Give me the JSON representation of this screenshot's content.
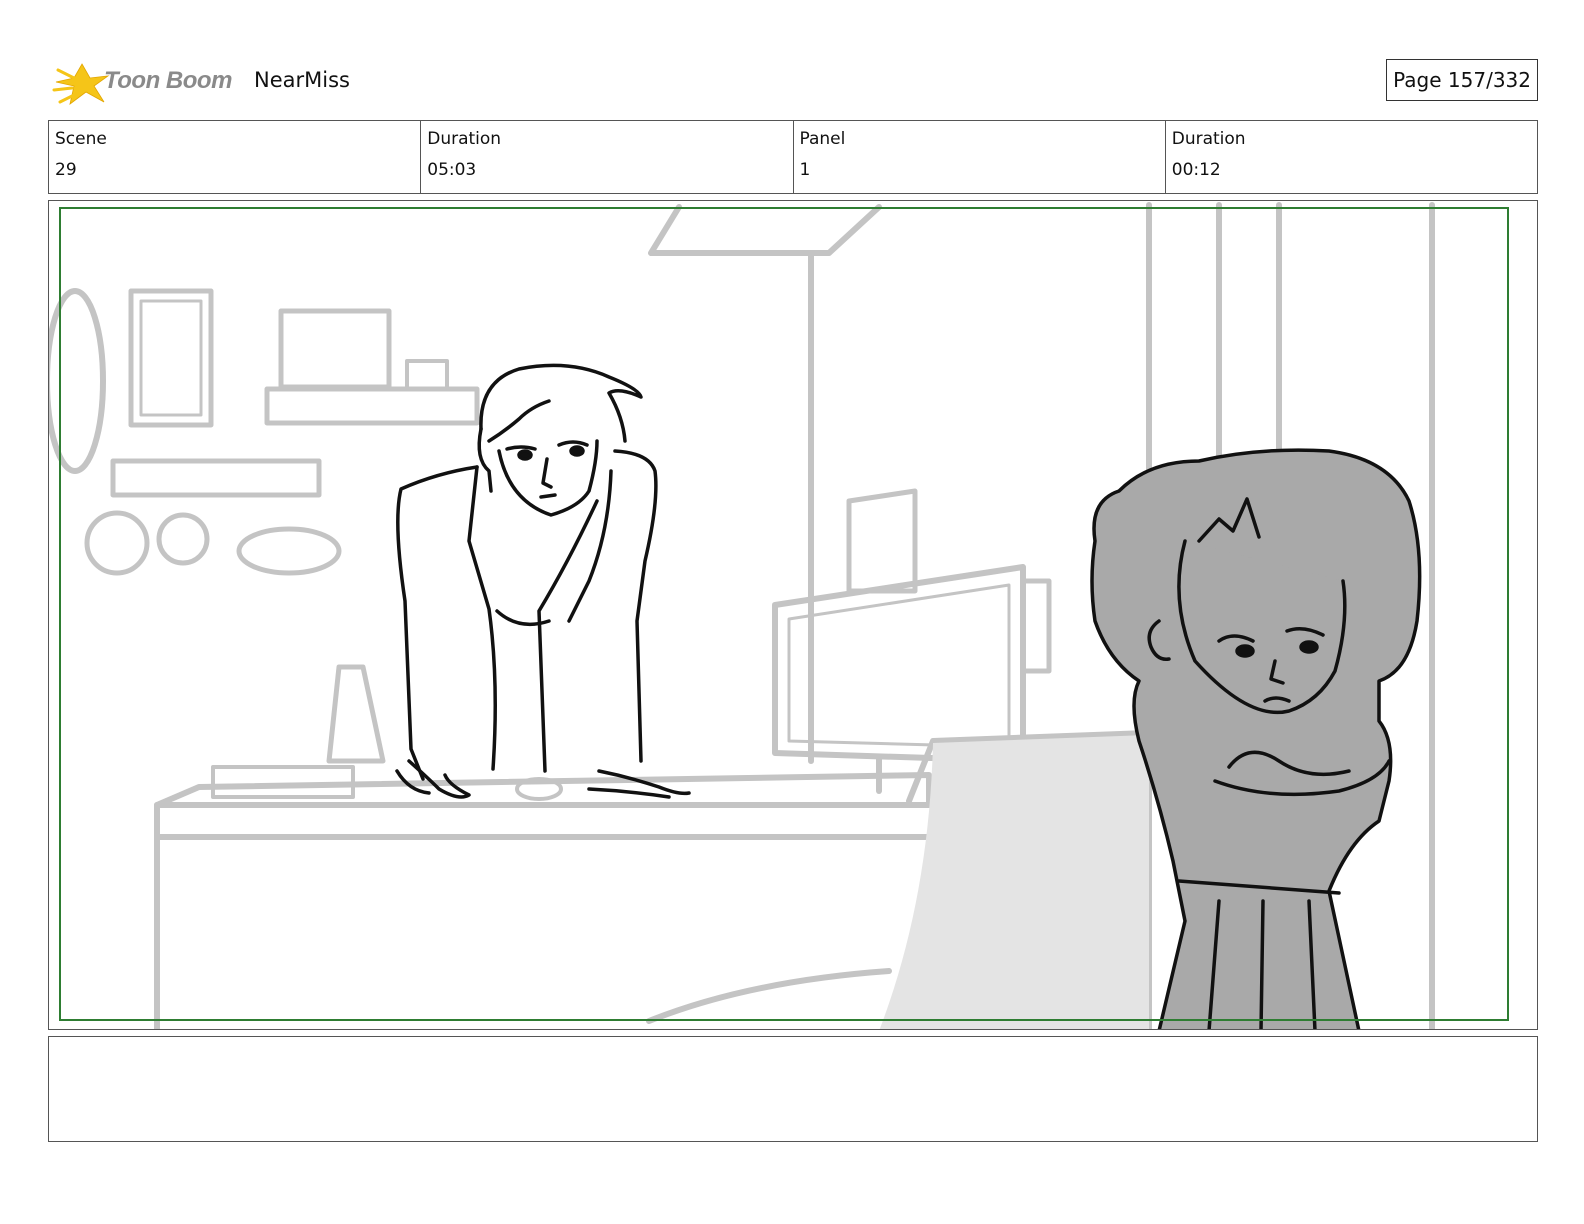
{
  "header": {
    "logo_text": "Toon Boom",
    "project_title": "NearMiss",
    "page_label": "Page 157/332"
  },
  "info": {
    "scene_label": "Scene",
    "scene_value": "29",
    "scene_duration_label": "Duration",
    "scene_duration_value": "05:03",
    "panel_label": "Panel",
    "panel_value": "1",
    "panel_duration_label": "Duration",
    "panel_duration_value": "00:12"
  },
  "notes": {
    "text": ""
  },
  "colors": {
    "safe_frame": "#2e7d32",
    "background_lines": "#c4c4c4",
    "character_fill": "#a9a9a9",
    "logo_star": "#f5c518"
  }
}
